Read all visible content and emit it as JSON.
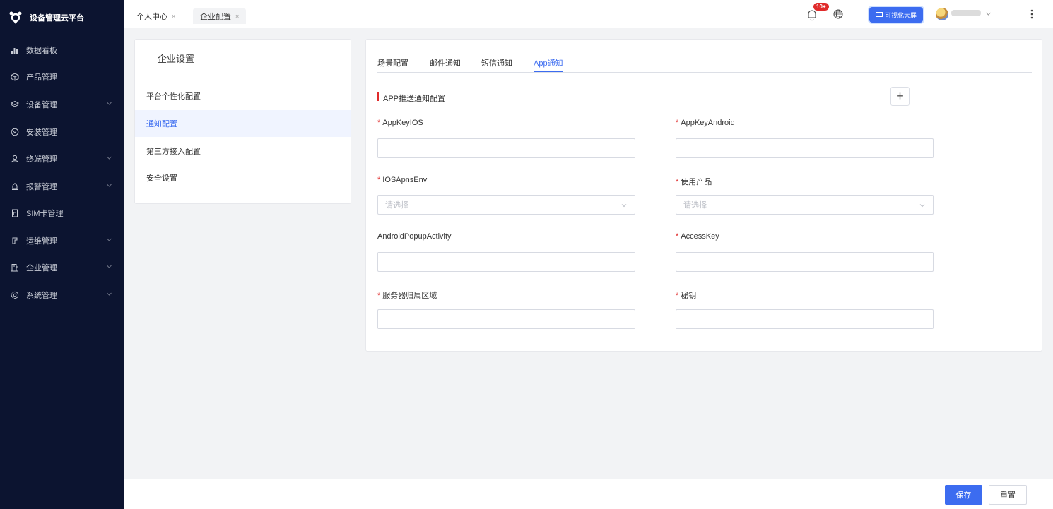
{
  "app": {
    "title": "设备管理云平台"
  },
  "sidebar": {
    "items": [
      {
        "label": "数据看板",
        "icon": "bar-chart-icon",
        "expandable": false
      },
      {
        "label": "产品管理",
        "icon": "cube-icon",
        "expandable": false
      },
      {
        "label": "设备管理",
        "icon": "layers-icon",
        "expandable": true
      },
      {
        "label": "安装管理",
        "icon": "install-icon",
        "expandable": false
      },
      {
        "label": "终端管理",
        "icon": "user-icon",
        "expandable": true
      },
      {
        "label": "报警管理",
        "icon": "alarm-icon",
        "expandable": true
      },
      {
        "label": "SIM卡管理",
        "icon": "sim-card-icon",
        "expandable": false
      },
      {
        "label": "运维管理",
        "icon": "wrench-icon",
        "expandable": true
      },
      {
        "label": "企业管理",
        "icon": "building-icon",
        "expandable": true
      },
      {
        "label": "系统管理",
        "icon": "gear-icon",
        "expandable": true
      }
    ]
  },
  "tabs": [
    {
      "label": "个人中心",
      "active": false
    },
    {
      "label": "企业配置",
      "active": true
    }
  ],
  "topbar": {
    "notification_badge": "10+",
    "visualization_button": "可视化大屏"
  },
  "settings": {
    "title": "企业设置",
    "items": [
      {
        "label": "平台个性化配置",
        "active": false
      },
      {
        "label": "通知配置",
        "active": true
      },
      {
        "label": "第三方接入配置",
        "active": false
      },
      {
        "label": "安全设置",
        "active": false
      }
    ]
  },
  "form": {
    "tabs": [
      "场景配置",
      "邮件通知",
      "短信通知",
      "App通知"
    ],
    "active_tab": "App通知",
    "section_title": "APP推送通知配置",
    "fields": {
      "appkey_ios": {
        "label": "AppKeyIOS",
        "value": "",
        "required": true
      },
      "appkey_android": {
        "label": "AppKeyAndroid",
        "value": "",
        "required": true
      },
      "ios_apns_env": {
        "label": "IOSApnsEnv",
        "placeholder": "请选择",
        "required": true
      },
      "use_product": {
        "label": "使用产品",
        "placeholder": "请选择",
        "required": true
      },
      "android_popup": {
        "label": "AndroidPopupActivity",
        "value": "",
        "required": false
      },
      "access_key": {
        "label": "AccessKey",
        "value": "",
        "required": true
      },
      "server_region": {
        "label": "服务器归属区域",
        "value": "",
        "required": true
      },
      "secret": {
        "label": "秘钥",
        "value": "",
        "required": true
      }
    },
    "required_mark": "*"
  },
  "footer": {
    "save_label": "保存",
    "reset_label": "重置"
  },
  "colors": {
    "primary": "#3c6cf0",
    "sidebar_bg": "#0c1430",
    "danger": "#e02b2b"
  }
}
